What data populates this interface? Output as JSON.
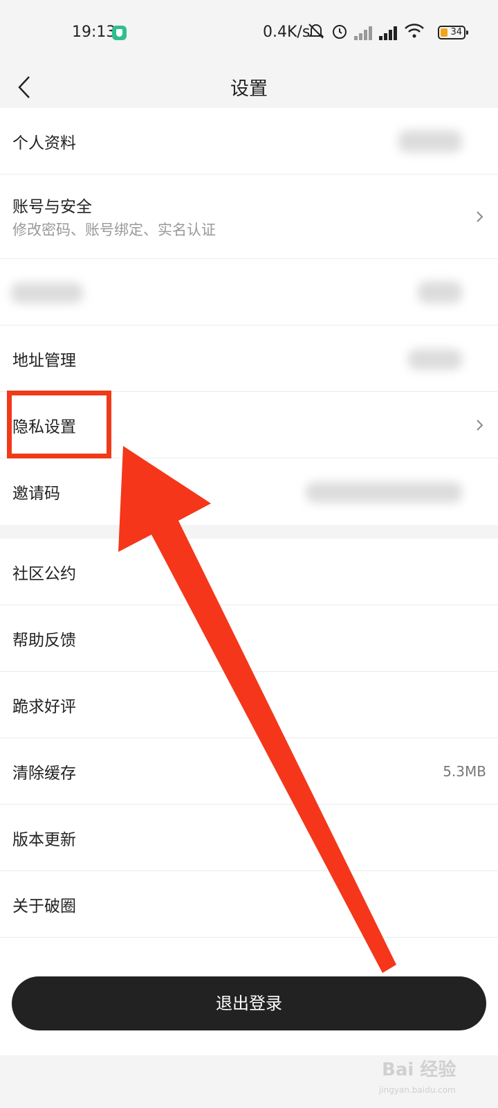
{
  "status_bar": {
    "time": "19:13",
    "net_speed": "0.4K/s",
    "battery": "34",
    "icons": [
      "shield-icon",
      "bell-muted-icon",
      "alarm-icon",
      "hd-signal-icon",
      "signal-icon",
      "wifi-icon",
      "battery-icon"
    ]
  },
  "header": {
    "title": "设置",
    "back_icon": "chevron-left-icon"
  },
  "group1": [
    {
      "label": "个人资料",
      "has_chevron": false,
      "blurred_value": true
    },
    {
      "label": "账号与安全",
      "sub": "修改密码、账号绑定、实名认证",
      "has_chevron": true
    },
    {
      "label": "",
      "blurred": true
    },
    {
      "label": "地址管理",
      "blurred_value": true
    },
    {
      "label": "隐私设置",
      "has_chevron": true
    },
    {
      "label": "邀请码",
      "blurred_value": true
    }
  ],
  "group2": [
    {
      "label": "社区公约"
    },
    {
      "label": "帮助反馈"
    },
    {
      "label": "跪求好评"
    },
    {
      "label": "清除缓存",
      "value": "5.3MB"
    },
    {
      "label": "版本更新"
    },
    {
      "label": "关于破圈"
    }
  ],
  "logout_label": "退出登录",
  "annotation": {
    "highlight_color": "#f03a1a"
  },
  "watermark": {
    "text": "Bai 经验",
    "sub": "jingyan.baidu.com"
  }
}
